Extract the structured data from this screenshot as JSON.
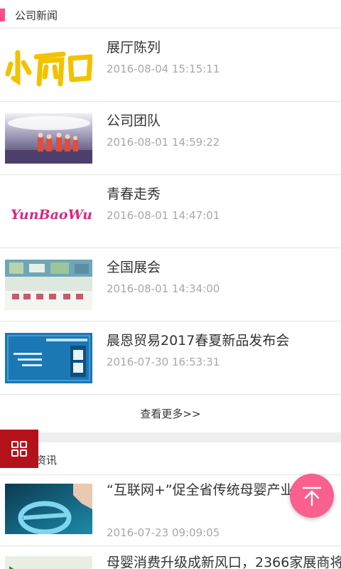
{
  "company_news": {
    "title": "公司新闻",
    "items": [
      {
        "title": "展厅陈列",
        "date": "2016-08-04 15:15:11",
        "thumb": "calligraphy-logo-image"
      },
      {
        "title": "公司团队",
        "date": "2016-08-01 14:59:22",
        "thumb": "team-stage-photo"
      },
      {
        "title": "青春走秀",
        "date": "2016-08-01 14:47:01",
        "thumb": "yunbaowu-logo-image",
        "logo_text": "YunBaoWu"
      },
      {
        "title": "全国展会",
        "date": "2016-08-01 14:34:00",
        "thumb": "exhibition-booth-photo"
      },
      {
        "title": "晨恩贸易2017春夏新品发布会",
        "date": "2016-07-30 16:53:31",
        "thumb": "invitation-card-image"
      }
    ],
    "more_label": "查看更多>>"
  },
  "industry_news": {
    "title": "资讯",
    "items": [
      {
        "title": "“互联网+”促全省传统母婴产业发展",
        "date": "2016-07-23 09:09:05",
        "thumb": "internet-e-logo-photo"
      },
      {
        "title": "母婴消费升级成新风口，2366家展商将",
        "thumb": "green-play-image"
      }
    ]
  },
  "floating": {
    "menu_icon": "grid-icon",
    "top_icon": "arrow-up-icon"
  },
  "colors": {
    "accent_pink": "#ff4d88",
    "menu_red": "#b4121b",
    "top_button_pink": "#f9608d"
  }
}
